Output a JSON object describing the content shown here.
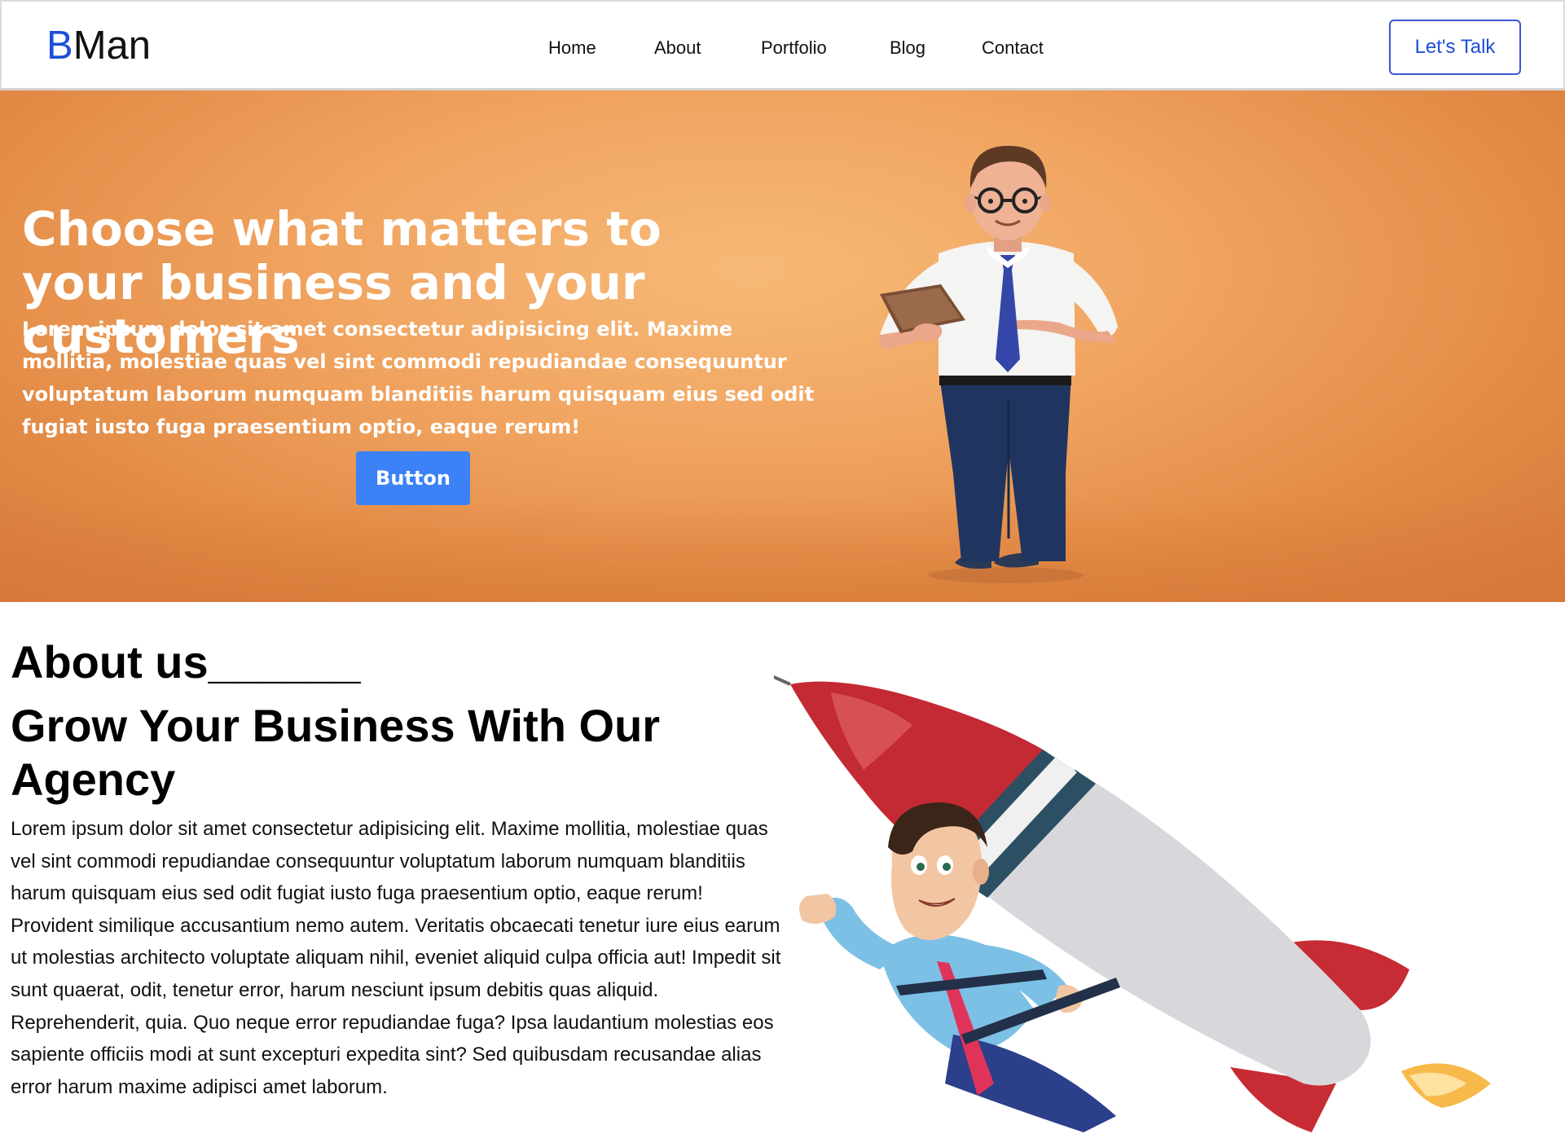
{
  "header": {
    "logo_first": "B",
    "logo_rest": "Man",
    "nav": [
      "Home",
      "About",
      "Portfolio",
      "Blog",
      "Contact"
    ],
    "cta_label": "Let's Talk",
    "brand_color": "#1d4ed8"
  },
  "hero": {
    "title": "Choose what matters to your business and your customers",
    "text": "Lorem ipsum dolor sit amet consectetur adipisicing elit. Maxime mollitia, molestiae quas vel sint commodi repudiandae consequuntur voluptatum laborum numquam blanditiis harum quisquam eius sed odit fugiat iusto fuga praesentium optio, eaque rerum!",
    "button_label": "Button",
    "button_color": "#3b82f6",
    "background_color": "#f0a460"
  },
  "about": {
    "kicker": "About us______",
    "title": "Grow Your Business With Our Agency",
    "text": "Lorem ipsum dolor sit amet consectetur adipisicing elit. Maxime mollitia, molestiae quas vel sint commodi repudiandae consequuntur voluptatum laborum numquam blanditiis harum quisquam eius sed odit fugiat iusto fuga praesentium optio, eaque rerum! Provident similique accusantium nemo autem. Veritatis obcaecati tenetur iure eius earum ut molestias architecto voluptate aliquam nihil, eveniet aliquid culpa officia aut! Impedit sit sunt quaerat, odit, tenetur error, harum nesciunt ipsum debitis quas aliquid. Reprehenderit, quia. Quo neque error repudiandae fuga? Ipsa laudantium molestias eos sapiente officiis modi at sunt excepturi expedita sint? Sed quibusdam recusandae alias error harum maxime adipisci amet laborum."
  }
}
